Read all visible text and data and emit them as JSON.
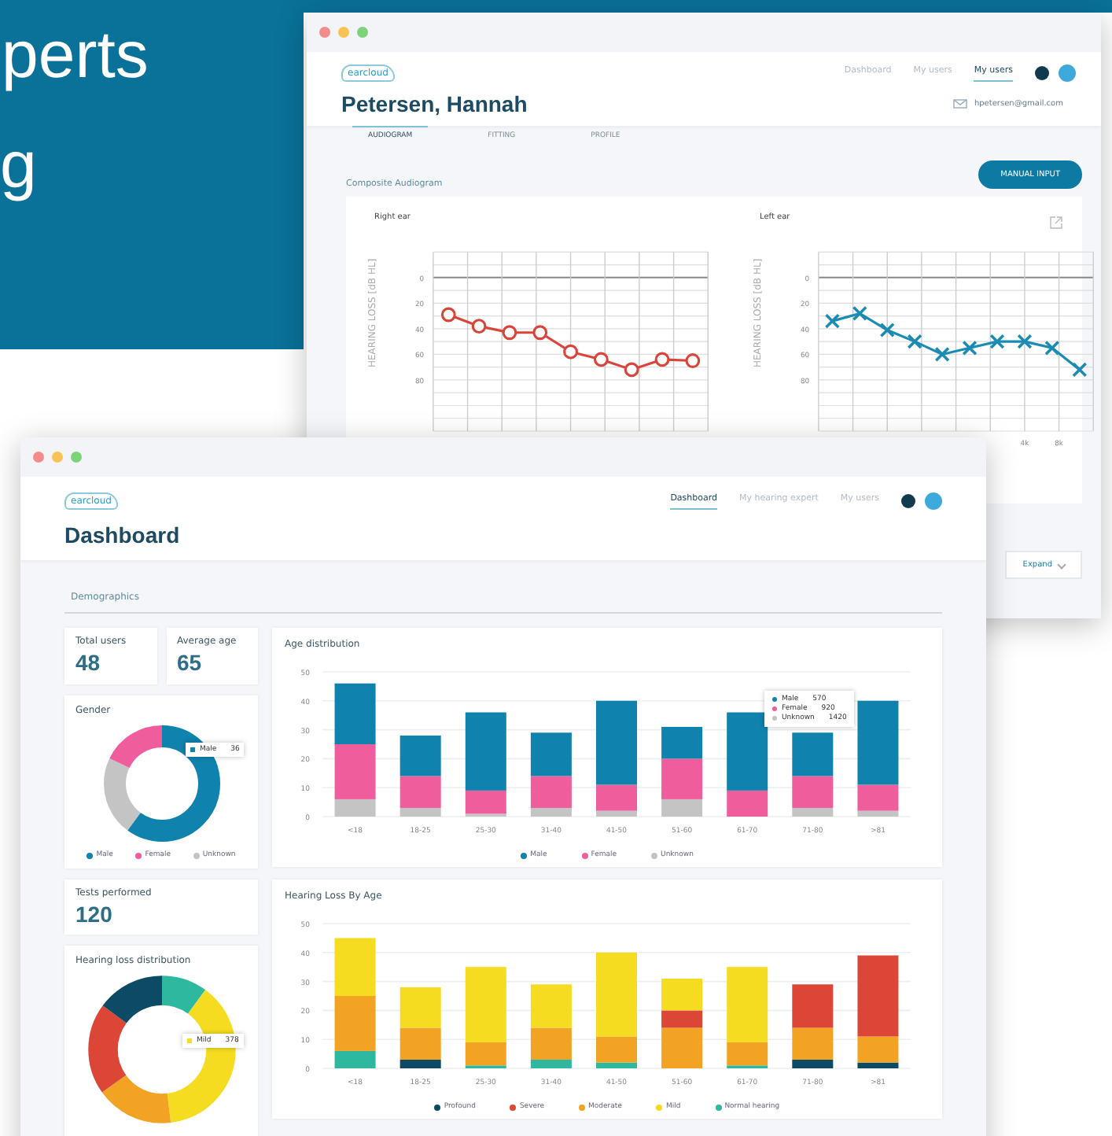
{
  "headline": [
    "perts",
    "g"
  ],
  "back_window": {
    "logo": "earcloud",
    "nav": [
      {
        "label": "Dashboard",
        "selected": false
      },
      {
        "label": "My users",
        "selected": false
      },
      {
        "label": "My users",
        "selected": true
      }
    ],
    "title": "Petersen, Hannah",
    "email": "hpetersen@gmail.com",
    "tabs": [
      {
        "label": "AUDIOGRAM",
        "selected": true
      },
      {
        "label": "FITTING",
        "selected": false
      },
      {
        "label": "PROFILE",
        "selected": false
      }
    ],
    "manual_input_button": "MANUAL INPUT",
    "section": "Composite Audiogram",
    "expand_button": "Expand",
    "audiograms": [
      {
        "chart_data": {
          "type": "line",
          "ylabel": "HEARING LOSS [dB HL]",
          "ylim": [
            120,
            -20
          ],
          "yticks": [
            0,
            20,
            40,
            60,
            80
          ],
          "grid": true,
          "categories": [
            null,
            null,
            null,
            null,
            null,
            null,
            null,
            null,
            null
          ],
          "series": [
            {
              "name": "Right ear",
              "color": "#d9453b",
              "marker": "circle",
              "values": [
                29,
                38,
                43,
                43,
                58,
                64,
                72,
                64,
                65
              ]
            }
          ]
        }
      },
      {
        "chart_data": {
          "type": "line",
          "ylabel": "HEARING LOSS [dB HL]",
          "ylim": [
            120,
            -20
          ],
          "yticks": [
            0,
            20,
            40,
            60,
            80
          ],
          "grid": true,
          "categories": [
            null,
            null,
            null,
            null,
            null,
            null,
            null,
            null,
            null,
            null
          ],
          "series": [
            {
              "name": "Left ear",
              "color": "#1a8bb3",
              "marker": "cross",
              "values": [
                34,
                28,
                41,
                50,
                60,
                55,
                50,
                50,
                55,
                72
              ]
            }
          ]
        },
        "frequency_labels": [
          "4k",
          "8k"
        ]
      }
    ]
  },
  "front_window": {
    "logo": "earcloud",
    "nav": [
      {
        "label": "Dashboard",
        "selected": true
      },
      {
        "label": "My hearing expert",
        "selected": false
      },
      {
        "label": "My users",
        "selected": false
      }
    ],
    "title": "Dashboard",
    "section": "Demographics",
    "stats": [
      {
        "label": "Total users",
        "value": "48"
      },
      {
        "label": "Average age",
        "value": "65"
      }
    ],
    "gender": {
      "title": "Gender",
      "tooltip": {
        "label": "Male",
        "value": "36"
      },
      "legend": [
        {
          "label": "Male",
          "color": "#0f82ad"
        },
        {
          "label": "Female",
          "color": "#ef5d9c"
        },
        {
          "label": "Unknown",
          "color": "#c4c4c4"
        }
      ]
    },
    "age_distribution": {
      "title": "Age distribution",
      "tooltip": [
        {
          "label": "Male",
          "value": "570",
          "color": "#0f82ad"
        },
        {
          "label": "Female",
          "value": "920",
          "color": "#ef5d9c"
        },
        {
          "label": "Unknown",
          "value": "1420",
          "color": "#c4c4c4"
        }
      ],
      "chart_data": {
        "type": "bar",
        "stacked": true,
        "grid": true,
        "categories": [
          "<18",
          "18-25",
          "25-30",
          "31-40",
          "41-50",
          "51-60",
          "61-70",
          "71-80",
          ">81"
        ],
        "ylim": [
          0,
          50
        ],
        "yticks": [
          0,
          10,
          20,
          30,
          40,
          50
        ],
        "series": [
          {
            "name": "Male",
            "color": "#0f82ad",
            "values": [
              21,
              14,
              27,
              15,
              29,
              11,
              27,
              15,
              29
            ]
          },
          {
            "name": "Female",
            "color": "#ef5d9c",
            "values": [
              19,
              11,
              8,
              11,
              9,
              14,
              9,
              11,
              9
            ]
          },
          {
            "name": "Unknown",
            "color": "#c4c4c4",
            "values": [
              6,
              3,
              1,
              3,
              2,
              6,
              0,
              3,
              2
            ]
          }
        ]
      }
    },
    "tests": {
      "label": "Tests performed",
      "value": "120"
    },
    "hearing_distribution": {
      "title": "Hearing loss distribution",
      "tooltip": {
        "label": "Mild",
        "value": "378"
      }
    },
    "hearing_by_age": {
      "title": "Hearing Loss By Age",
      "chart_data": {
        "type": "bar",
        "stacked": true,
        "grid": true,
        "categories": [
          "<18",
          "18-25",
          "25-30",
          "31-40",
          "41-50",
          "51-60",
          "61-70",
          "71-80",
          ">81"
        ],
        "ylim": [
          0,
          50
        ],
        "yticks": [
          0,
          10,
          20,
          30,
          40,
          50
        ],
        "series": [
          {
            "name": "Profound",
            "color": "#0d4a66",
            "values": [
              0,
              3,
              0,
              0,
              0,
              0,
              0,
              3,
              2
            ]
          },
          {
            "name": "Severe",
            "color": "#dc4637",
            "values": [
              0,
              0,
              0,
              0,
              0,
              6,
              0,
              15,
              28
            ]
          },
          {
            "name": "Moderate",
            "color": "#f2a324",
            "values": [
              19,
              11,
              8,
              11,
              9,
              14,
              8,
              11,
              9
            ]
          },
          {
            "name": "Mild",
            "color": "#f5dc20",
            "values": [
              20,
              14,
              26,
              15,
              29,
              11,
              26,
              0,
              0
            ]
          },
          {
            "name": "Normal hearing",
            "color": "#2fb8a0",
            "values": [
              6,
              0,
              1,
              3,
              2,
              0,
              1,
              0,
              0
            ]
          }
        ]
      }
    }
  }
}
